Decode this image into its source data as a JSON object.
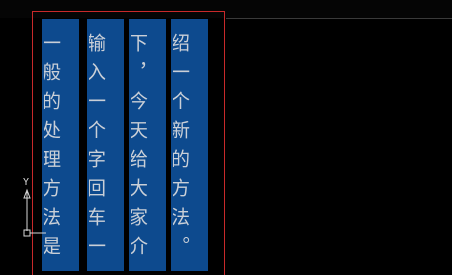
{
  "canvas": {
    "background": "#000000",
    "text_color": "#c9cfd7",
    "highlight_color": "#0d4a8e",
    "frame_color": "#c8292a"
  },
  "text_columns": [
    {
      "text": "一般的处理方法是"
    },
    {
      "text": "输入一个字回车一"
    },
    {
      "text": "下，今天给大家介"
    },
    {
      "text": "绍一个新的方法。"
    }
  ],
  "ucs": {
    "axis_label": "Y",
    "icon": "ucs-axis-icon"
  }
}
